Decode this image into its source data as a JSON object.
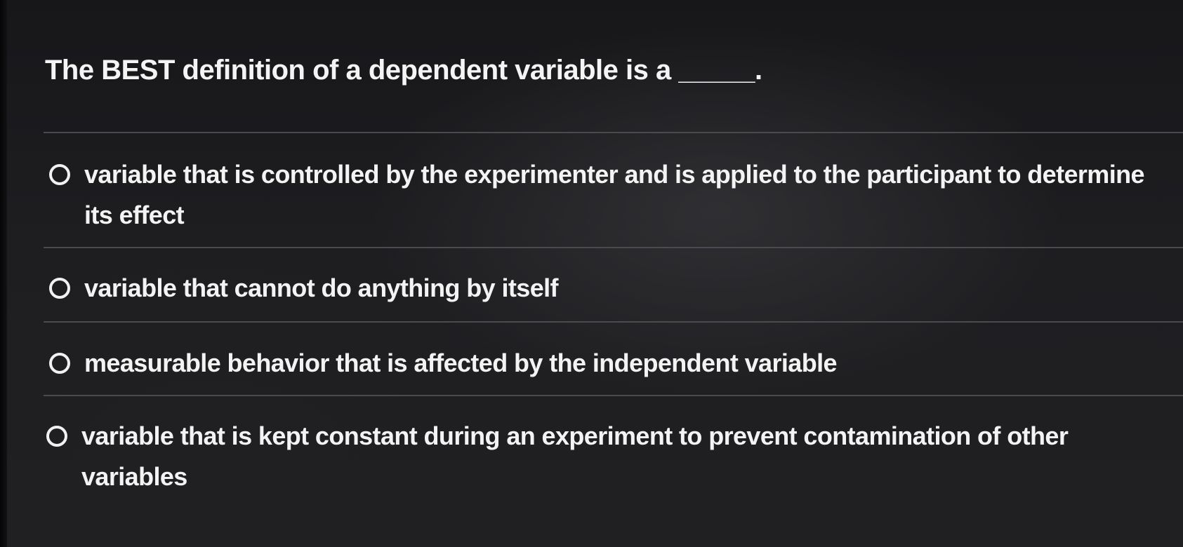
{
  "question": {
    "text": "The BEST definition of a dependent variable is a _____."
  },
  "options": [
    {
      "line1": "variable that is controlled by the experimenter and is applied to the participant to determine",
      "line2": "its effect",
      "selected": false
    },
    {
      "line1": "variable that cannot do anything by itself",
      "line2": "",
      "selected": false
    },
    {
      "line1": "measurable behavior that is affected by the independent variable",
      "line2": "",
      "selected": false
    },
    {
      "line1": "variable that is kept constant during an experiment to prevent contamination of other",
      "line2": "variables",
      "selected": false
    }
  ],
  "colors": {
    "background": "#1d1d1f",
    "text": "#f3f3f3",
    "divider": "#4b4b4f"
  }
}
